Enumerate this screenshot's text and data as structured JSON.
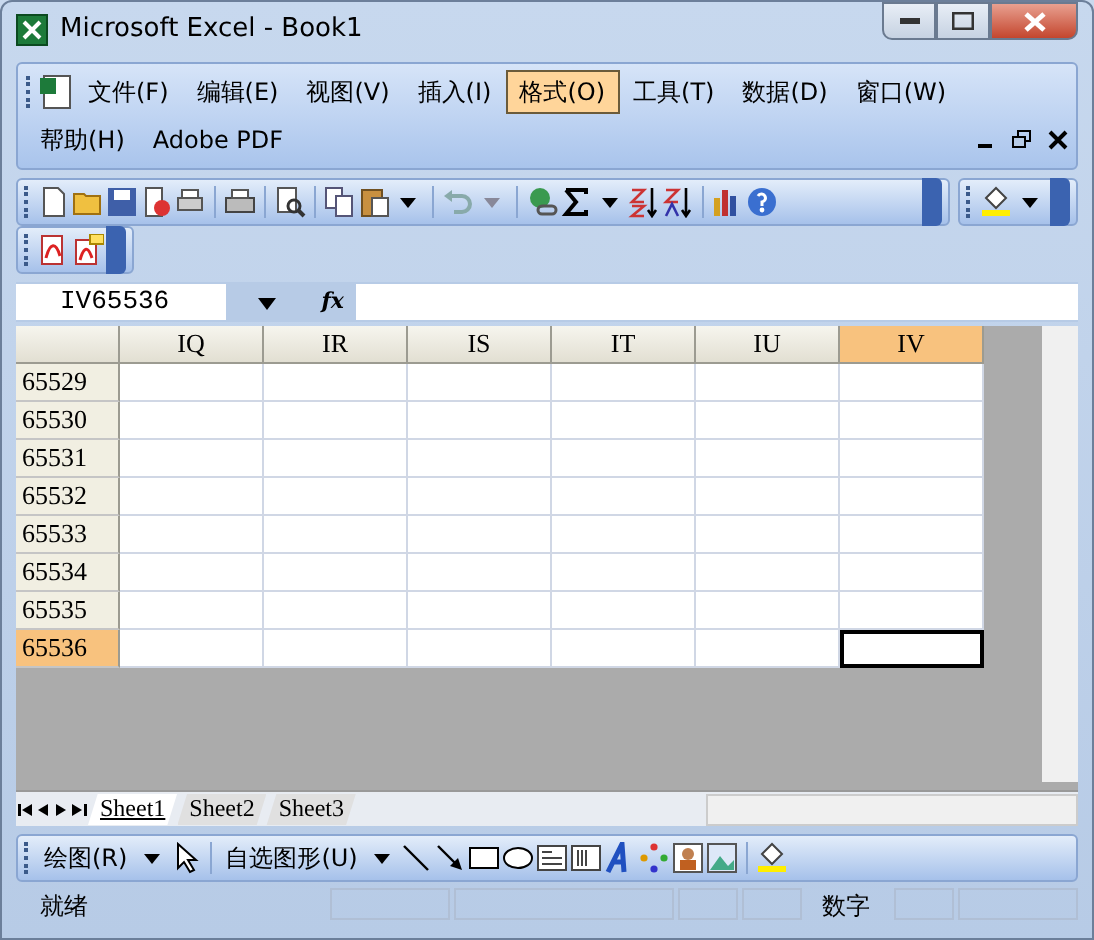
{
  "window": {
    "title": "Microsoft Excel - Book1"
  },
  "menu": [
    {
      "label": "文件(F)",
      "selected": false
    },
    {
      "label": "编辑(E)",
      "selected": false
    },
    {
      "label": "视图(V)",
      "selected": false
    },
    {
      "label": "插入(I)",
      "selected": false
    },
    {
      "label": "格式(O)",
      "selected": true
    },
    {
      "label": "工具(T)",
      "selected": false
    },
    {
      "label": "数据(D)",
      "selected": false
    },
    {
      "label": "窗口(W)",
      "selected": false
    },
    {
      "label": "帮助(H)",
      "selected": false
    },
    {
      "label": "Adobe PDF",
      "selected": false
    }
  ],
  "formula_bar": {
    "name_box": "IV65536",
    "fx": "fx"
  },
  "grid": {
    "columns": [
      {
        "label": "IQ",
        "selected": false
      },
      {
        "label": "IR",
        "selected": false
      },
      {
        "label": "IS",
        "selected": false
      },
      {
        "label": "IT",
        "selected": false
      },
      {
        "label": "IU",
        "selected": false
      },
      {
        "label": "IV",
        "selected": true
      }
    ],
    "rows": [
      {
        "label": "65529",
        "selected": false
      },
      {
        "label": "65530",
        "selected": false
      },
      {
        "label": "65531",
        "selected": false
      },
      {
        "label": "65532",
        "selected": false
      },
      {
        "label": "65533",
        "selected": false
      },
      {
        "label": "65534",
        "selected": false
      },
      {
        "label": "65535",
        "selected": false
      },
      {
        "label": "65536",
        "selected": true
      }
    ]
  },
  "sheet_tabs": [
    {
      "label": "Sheet1",
      "selected": true
    },
    {
      "label": "Sheet2",
      "selected": false
    },
    {
      "label": "Sheet3",
      "selected": false
    }
  ],
  "drawing_toolbar": {
    "draw_menu": "绘图(R)",
    "autoshapes_menu": "自选图形(U)"
  },
  "status_bar": {
    "status": "就绪",
    "mode": "数字"
  }
}
